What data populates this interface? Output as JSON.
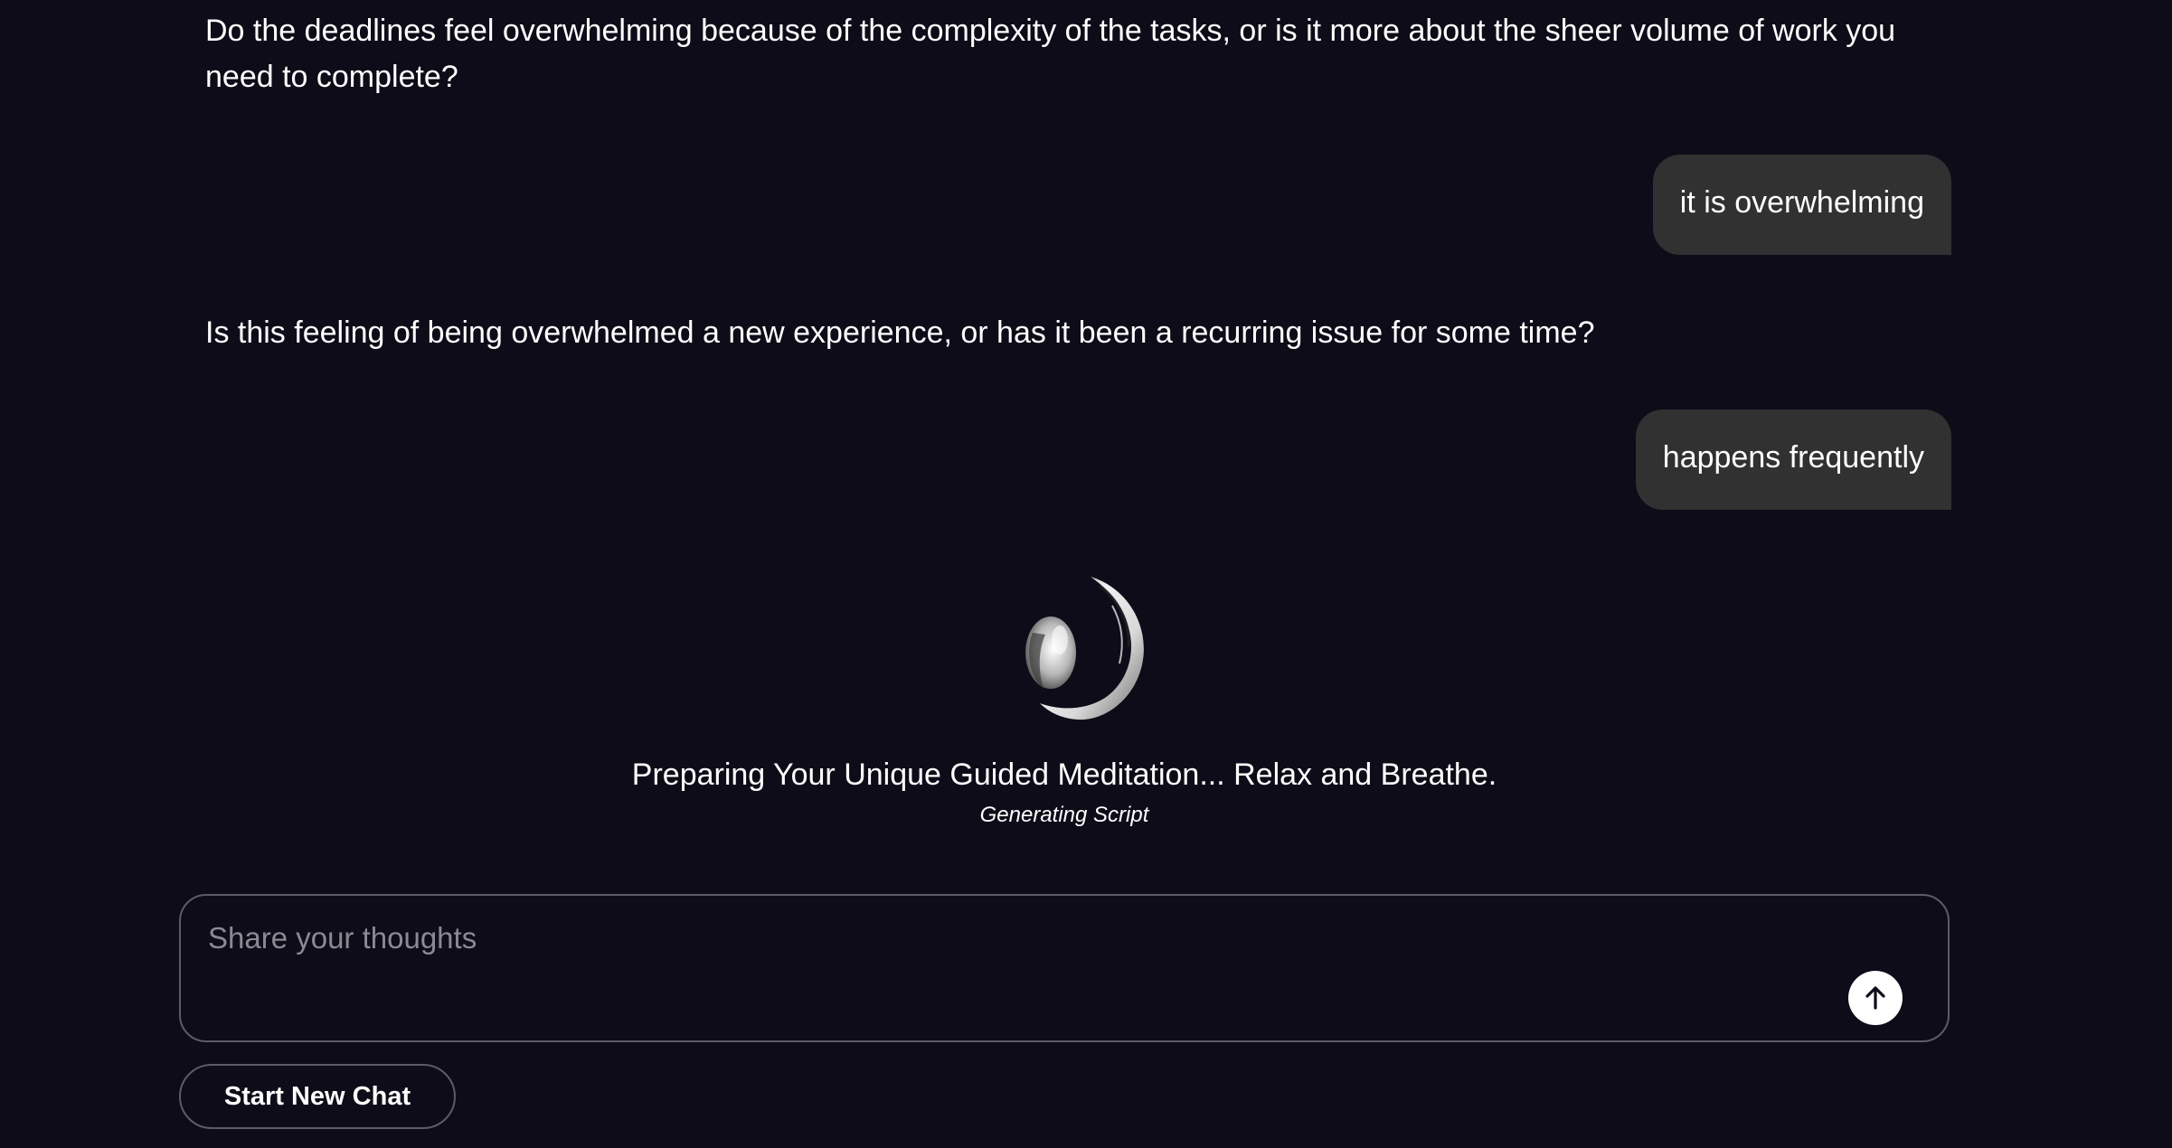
{
  "conversation": {
    "messages": [
      {
        "role": "assistant",
        "text": "Do the deadlines feel overwhelming because of the complexity of the tasks, or is it more about the sheer volume of work you need to complete?"
      },
      {
        "role": "user",
        "text": "it is overwhelming"
      },
      {
        "role": "assistant",
        "text": "Is this feeling of being overwhelmed a new experience, or has it been a recurring issue for some time?"
      },
      {
        "role": "user",
        "text": "happens frequently"
      }
    ]
  },
  "status": {
    "icon": "spinner-icon",
    "title": "Preparing Your Unique Guided Meditation... Relax and Breathe.",
    "subtitle": "Generating Script"
  },
  "composer": {
    "placeholder": "Share your thoughts",
    "value": "",
    "send_icon": "arrow-up-icon"
  },
  "actions": {
    "new_chat_label": "Start New Chat"
  },
  "colors": {
    "background": "#0d0c18",
    "user_bubble": "#313131",
    "border": "#5c5b66",
    "text": "#ffffff",
    "placeholder": "#8a8a93"
  }
}
